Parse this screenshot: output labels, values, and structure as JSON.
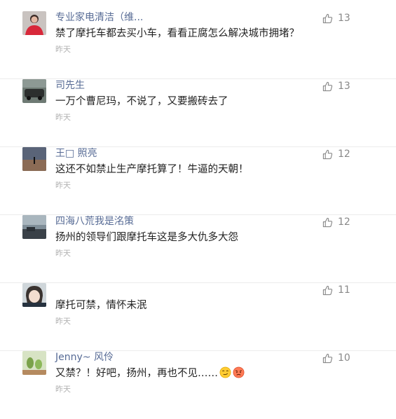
{
  "comments": [
    {
      "author": "专业家电清洁（维...",
      "content": "禁了摩托车都去买小车，看看正腐怎么解决城市拥堵？",
      "time": "昨天",
      "likes": "13",
      "avatar": "avatar-woman-red"
    },
    {
      "author": "司先生",
      "content": "一万个曹尼玛，不说了，又要搬砖去了",
      "time": "昨天",
      "likes": "13",
      "avatar": "avatar-car"
    },
    {
      "author": "王□ 照亮",
      "content": "这还不如禁止生产摩托算了！牛逼的天朝！",
      "time": "昨天",
      "likes": "12",
      "avatar": "avatar-sunset"
    },
    {
      "author": "四海八荒我是洺策",
      "content": "扬州的领导们跟摩托车这是多大仇多大怨",
      "time": "昨天",
      "likes": "12",
      "avatar": "avatar-landscape"
    },
    {
      "author": "",
      "content": "摩托可禁，情怀未泯",
      "time": "昨天",
      "likes": "11",
      "avatar": "avatar-anime"
    },
    {
      "author": "Jenny~ 风伶",
      "content": "又禁？！好吧，扬州，再也不见……",
      "time": "昨天",
      "likes": "10",
      "avatar": "avatar-plant",
      "emojis": [
        "smirk-emoji",
        "angry-emoji"
      ]
    }
  ]
}
